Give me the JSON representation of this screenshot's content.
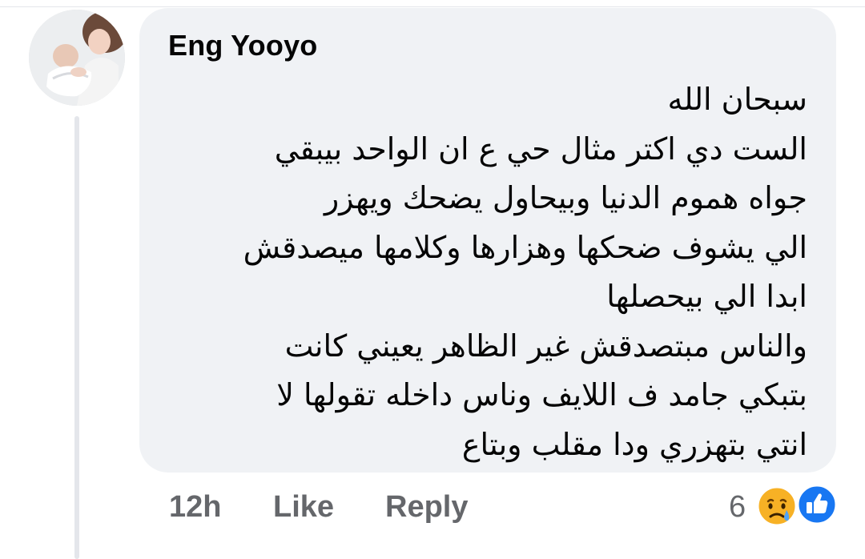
{
  "comment": {
    "author": "Eng Yooyo",
    "lines": [
      "سبحان الله",
      "الست دي اكتر مثال حي ع ان الواحد بيبقي",
      "جواه هموم الدنيا وبيحاول يضحك ويهزر",
      "الي يشوف ضحكها وهزارها وكلامها ميصدقش",
      "ابدا الي بيحصلها",
      "والناس مبتصدقش غير الظاهر يعيني كانت",
      "بتبكي جامد ف اللايف وناس داخله تقولها لا",
      "انتي بتهزري ودا مقلب وبتاع"
    ]
  },
  "actions": {
    "timestamp": "12h",
    "like_label": "Like",
    "reply_label": "Reply"
  },
  "reactions": {
    "count": "6",
    "icons": [
      "crying-face-icon",
      "like-thumb-icon"
    ]
  },
  "colors": {
    "bubble": "#f0f2f5",
    "text": "#050505",
    "secondary_text": "#65676b",
    "like_blue": "#1877f2"
  }
}
